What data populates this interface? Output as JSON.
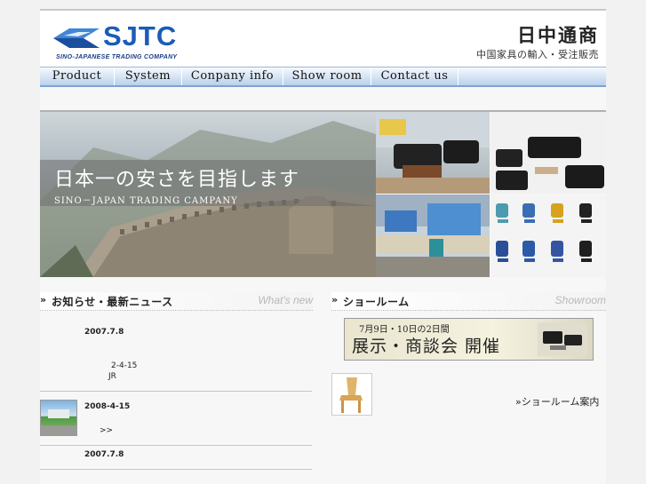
{
  "header": {
    "logo_text": "SJTC",
    "logo_subtitle": "SINO-JAPANESE TRADING COMPANY",
    "company_name_jp": "日中通商",
    "company_tagline_jp": "中国家具の輸入・受注販売"
  },
  "nav": {
    "items": [
      "Product",
      "System",
      "Conpany info",
      "Show room",
      "Contact us"
    ]
  },
  "banner": {
    "catch_main": "日本一の安さを目指します",
    "catch_sub": "SINO－JAPAN TRADING CAMPANY"
  },
  "news": {
    "title_jp": "お知らせ・最新ニュース",
    "title_en": "What's new",
    "items": [
      {
        "date": "2007.7.8",
        "lines": [
          "2-4-15",
          "JR"
        ]
      },
      {
        "date": "2008-4-15",
        "lines": [
          ">>"
        ]
      },
      {
        "date": "2007.7.8",
        "lines": []
      }
    ]
  },
  "showroom": {
    "title_jp": "ショールーム",
    "title_en": "Showroom",
    "exhibit_small": "7月9日・10日の2日間",
    "exhibit_big": "展示・商談会 開催",
    "link_text": "»ショールーム案内"
  },
  "colors": {
    "brand_blue": "#1a5cb8",
    "nav_border": "#7fa2cf",
    "page_bg": "#f2f2f2"
  }
}
